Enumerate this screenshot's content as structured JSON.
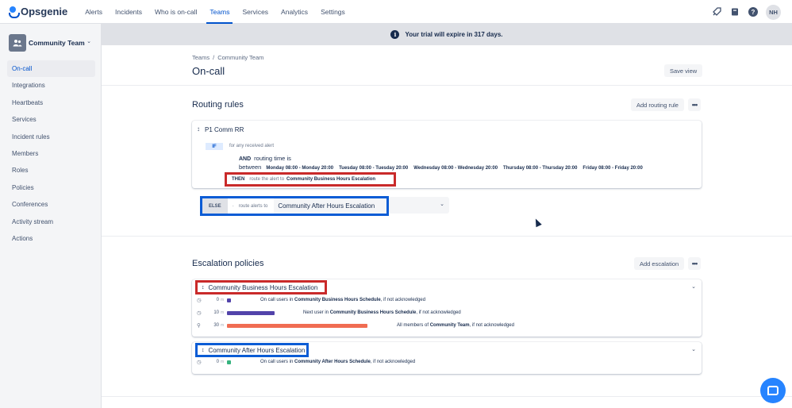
{
  "app": {
    "name": "Opsgenie"
  },
  "nav": {
    "items": [
      {
        "label": "Alerts",
        "active": false
      },
      {
        "label": "Incidents",
        "active": false
      },
      {
        "label": "Who is on-call",
        "active": false
      },
      {
        "label": "Teams",
        "active": true
      },
      {
        "label": "Services",
        "active": false
      },
      {
        "label": "Analytics",
        "active": false
      },
      {
        "label": "Settings",
        "active": false
      }
    ],
    "user_initials": "NH",
    "icons": [
      "rocket-icon",
      "book-icon",
      "help-icon"
    ]
  },
  "sidebar": {
    "team_name": "Community Team",
    "items": [
      {
        "label": "On-call",
        "active": true
      },
      {
        "label": "Integrations",
        "active": false
      },
      {
        "label": "Heartbeats",
        "active": false
      },
      {
        "label": "Services",
        "active": false
      },
      {
        "label": "Incident rules",
        "active": false
      },
      {
        "label": "Members",
        "active": false
      },
      {
        "label": "Roles",
        "active": false
      },
      {
        "label": "Policies",
        "active": false
      },
      {
        "label": "Conferences",
        "active": false
      },
      {
        "label": "Activity stream",
        "active": false
      },
      {
        "label": "Actions",
        "active": false
      }
    ]
  },
  "banner": {
    "text": "Your trial will expire in 317 days."
  },
  "breadcrumb": {
    "root": "Teams",
    "sep": "/",
    "current": "Community Team"
  },
  "page": {
    "title": "On-call",
    "save_view": "Save view"
  },
  "routing": {
    "title": "Routing rules",
    "add_label": "Add routing rule",
    "rule": {
      "name": "P1 Comm RR",
      "if_label": "IF",
      "if_text": "for any received alert",
      "and_label": "AND",
      "condition": "routing time is between",
      "slots": [
        "Monday 08:00 - Monday 20:00",
        "Tuesday 08:00 - Tuesday 20:00",
        "Wednesday 08:00 - Wednesday 20:00",
        "Thursday 08:00 - Thursday 20:00",
        "Friday 08:00 - Friday 20:00"
      ],
      "then_label": "THEN",
      "then_text": "route the alert to",
      "then_dest": "Community Business Hours Escalation"
    },
    "else": {
      "label": "ELSE",
      "dot": "-",
      "text": "route alerts to",
      "dest": "Community After Hours Escalation"
    }
  },
  "escalation": {
    "title": "Escalation policies",
    "add_label": "Add escalation",
    "policies": [
      {
        "name": "Community Business Hours Escalation",
        "highlight": "#C92A2A",
        "steps": [
          {
            "delay": "0",
            "unit": "m",
            "bar_fraction": 0.0,
            "color": "#5243AA",
            "icon": "schedule-icon",
            "prefix": "On call users in ",
            "target": "Community Business Hours Schedule",
            "suffix": ", if not acknowledged"
          },
          {
            "delay": "10",
            "unit": "m",
            "bar_fraction": 0.33,
            "color": "#5243AA",
            "icon": "schedule-icon",
            "prefix": "Next user in ",
            "target": "Community Business Hours Schedule",
            "suffix": ", if not acknowledged"
          },
          {
            "delay": "30",
            "unit": "m",
            "bar_fraction": 1.0,
            "color": "#F06C52",
            "icon": "team-icon",
            "prefix": "All members of ",
            "target": "Community Team",
            "suffix": ", if not acknowledged"
          }
        ]
      },
      {
        "name": "Community After Hours Escalation",
        "highlight": "#0B5CD5",
        "steps": [
          {
            "delay": "0",
            "unit": "m",
            "bar_fraction": 0.0,
            "color": "#36B37E",
            "icon": "schedule-icon",
            "prefix": "On call users in ",
            "target": "Community After Hours Schedule",
            "suffix": ", if not acknowledged"
          }
        ]
      }
    ]
  }
}
